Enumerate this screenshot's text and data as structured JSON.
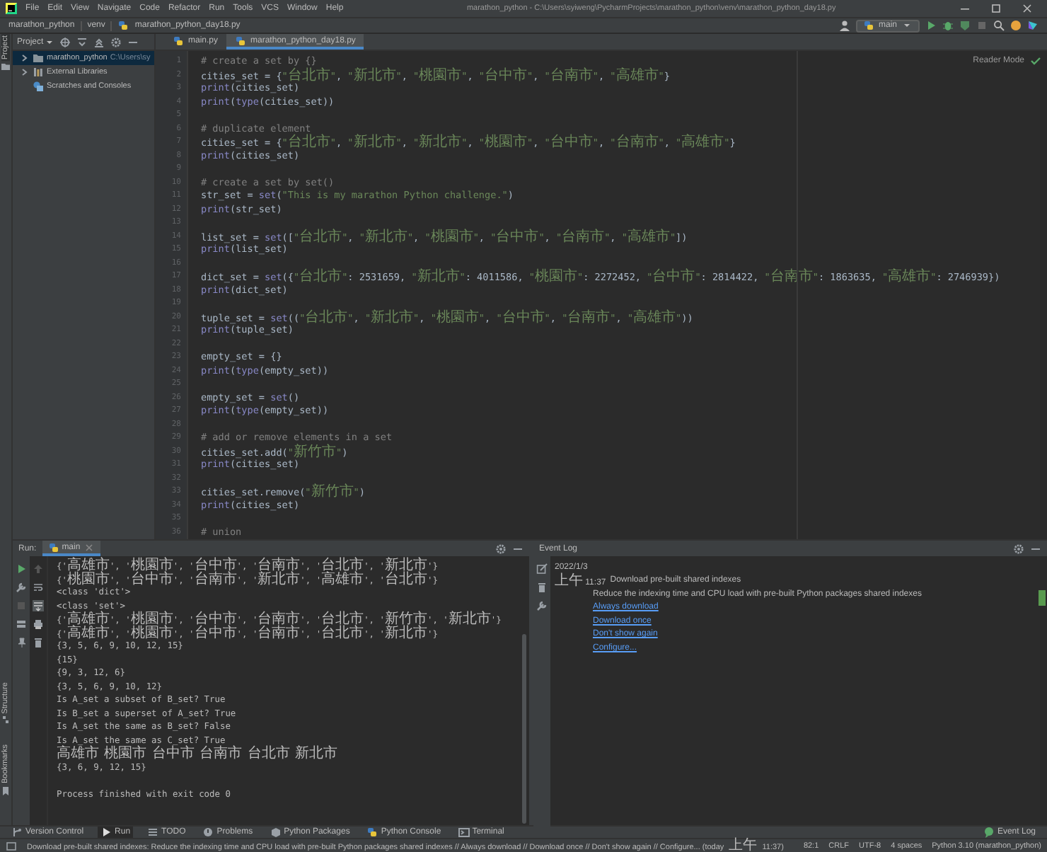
{
  "menu_bar": {
    "items": [
      "File",
      "Edit",
      "View",
      "Navigate",
      "Code",
      "Refactor",
      "Run",
      "Tools",
      "VCS",
      "Window",
      "Help"
    ],
    "title": "marathon_python - C:\\Users\\syiweng\\PycharmProjects\\marathon_python\\venv\\marathon_python_day18.py"
  },
  "nav_bar": {
    "breadcrumbs": [
      "marathon_python",
      "venv",
      "marathon_python_day18.py"
    ],
    "run_config": "main"
  },
  "left_strip": [
    {
      "label": "Project",
      "kind": "project",
      "selected": true
    },
    {
      "label": "Structure",
      "kind": "structure",
      "selected": false
    },
    {
      "label": "Bookmarks",
      "kind": "bookmarks",
      "selected": false
    }
  ],
  "project_panel": {
    "title": "Project",
    "tree": [
      {
        "label": "marathon_python",
        "path": "C:\\Users\\sy",
        "kind": "folder",
        "selected": true
      },
      {
        "label": "External Libraries",
        "kind": "library",
        "selected": false
      },
      {
        "label": "Scratches and Consoles",
        "kind": "scratches",
        "selected": false
      }
    ]
  },
  "editor": {
    "tabs": [
      {
        "label": "main.py",
        "selected": false
      },
      {
        "label": "marathon_python_day18.py",
        "selected": true
      }
    ],
    "reader_mode": "Reader Mode",
    "lines": [
      {
        "number": "1",
        "text": "# create a set by {}"
      },
      {
        "number": "2",
        "text": "cities_set = {\"台北市\", \"新北市\", \"桃園市\", \"台中市\", \"台南市\", \"高雄市\"}"
      },
      {
        "number": "3",
        "text": "print(cities_set)"
      },
      {
        "number": "4",
        "text": "print(type(cities_set))"
      },
      {
        "number": "5"
      },
      {
        "number": "6",
        "text": "# duplicate element"
      },
      {
        "number": "7",
        "text": "cities_set = {\"台北市\", \"新北市\", \"新北市\", \"桃園市\", \"台中市\", \"台南市\", \"高雄市\"}"
      },
      {
        "number": "8",
        "text": "print(cities_set)"
      },
      {
        "number": "9"
      },
      {
        "number": "10",
        "text": "# create a set by set()"
      },
      {
        "number": "11",
        "text": "str_set = set(\"This is my marathon Python challenge.\")"
      },
      {
        "number": "12",
        "text": "print(str_set)"
      },
      {
        "number": "13"
      },
      {
        "number": "14",
        "text": "list_set = set([\"台北市\", \"新北市\", \"桃園市\", \"台中市\", \"台南市\", \"高雄市\"])"
      },
      {
        "number": "15",
        "text": "print(list_set)"
      },
      {
        "number": "16"
      },
      {
        "number": "17",
        "text": "dict_set = set({\"台北市\": 2531659, \"新北市\": 4011586, \"桃園市\": 2272452, \"台中市\": 2814422, \"台南市\": 1863635, \"高雄市\": 2746939})"
      },
      {
        "number": "18",
        "text": "print(dict_set)"
      },
      {
        "number": "19"
      },
      {
        "number": "20",
        "text": "tuple_set = set((\"台北市\", \"新北市\", \"桃園市\", \"台中市\", \"台南市\", \"高雄市\"))"
      },
      {
        "number": "21",
        "text": "print(tuple_set)"
      },
      {
        "number": "22"
      },
      {
        "number": "23",
        "text": "empty_set = {}"
      },
      {
        "number": "24",
        "text": "print(type(empty_set))"
      },
      {
        "number": "25"
      },
      {
        "number": "26",
        "text": "empty_set = set()"
      },
      {
        "number": "27",
        "text": "print(type(empty_set))"
      },
      {
        "number": "28"
      },
      {
        "number": "29",
        "text": "# add or remove elements in a set"
      },
      {
        "number": "30",
        "text": "cities_set.add(\"新竹市\")"
      },
      {
        "number": "31",
        "text": "print(cities_set)"
      },
      {
        "number": "32"
      },
      {
        "number": "33",
        "text": "cities_set.remove(\"新竹市\")"
      },
      {
        "number": "34",
        "text": "print(cities_set)"
      },
      {
        "number": "35"
      },
      {
        "number": "36",
        "text": "# union"
      }
    ]
  },
  "run_panel": {
    "title": "Run:",
    "tab": "main",
    "output": [
      {
        "kind": "stdout",
        "text": "{'高雄市', '桃園市', '台中市', '台南市', '台北市', '新北市'}"
      },
      {
        "kind": "stdout",
        "text": "{'桃園市', '台中市', '台南市', '新北市', '高雄市', '台北市'}"
      },
      {
        "kind": "stdout",
        "text": "<class 'dict'>"
      },
      {
        "kind": "stdout",
        "text": "<class 'set'>"
      },
      {
        "kind": "stdout",
        "text": "{'高雄市', '桃園市', '台中市', '台南市', '台北市', '新竹市', '新北市'}"
      },
      {
        "kind": "stdout",
        "text": "{'高雄市', '桃園市', '台中市', '台南市', '台北市', '新北市'}"
      },
      {
        "kind": "stdout",
        "text": "{3, 5, 6, 9, 10, 12, 15}"
      },
      {
        "kind": "stdout",
        "text": "{15}"
      },
      {
        "kind": "stdout",
        "text": "{9, 3, 12, 6}"
      },
      {
        "kind": "stdout",
        "text": "{3, 5, 6, 9, 10, 12}"
      },
      {
        "kind": "stdout",
        "text": "Is A_set a subset of B_set? True"
      },
      {
        "kind": "stdout",
        "text": "Is B_set a superset of A_set? True"
      },
      {
        "kind": "stdout",
        "text": "Is A_set the same as B_set? False"
      },
      {
        "kind": "stdout",
        "text": "Is A_set the same as C_set? True"
      },
      {
        "kind": "stdout",
        "text": "高雄市 桃園市 台中市 台南市 台北市 新北市"
      },
      {
        "kind": "stdout",
        "text": "{3, 6, 9, 12, 15}"
      },
      {
        "kind": "exit",
        "text": "Process finished with exit code 0"
      }
    ]
  },
  "event_log": {
    "title": "Event Log",
    "date": "2022/1/3",
    "time": "上午 11:37",
    "heading": "Download pre-built shared indexes",
    "message": "Reduce the indexing time and CPU load with pre-built Python packages shared indexes",
    "links": [
      "Always download",
      "Download once",
      "Don't show again",
      "Configure..."
    ]
  },
  "tool_windows": [
    {
      "label": "Version Control",
      "kind": "vcs",
      "selected": false
    },
    {
      "label": "Run",
      "kind": "run",
      "selected": true
    },
    {
      "label": "TODO",
      "kind": "todo",
      "selected": false
    },
    {
      "label": "Problems",
      "kind": "problems",
      "selected": false
    },
    {
      "label": "Python Packages",
      "kind": "packages",
      "selected": false
    },
    {
      "label": "Python Console",
      "kind": "console",
      "selected": false
    },
    {
      "label": "Terminal",
      "kind": "terminal",
      "selected": false
    }
  ],
  "event_log_button": "Event Log",
  "status_bar": {
    "message": "Download pre-built shared indexes: Reduce the indexing time and CPU load with pre-built Python packages shared indexes // Always download // Download once // Don't show again // Configure... (today 上午 11:37)",
    "position": "82:1",
    "line_separator": "CRLF",
    "encoding": "UTF-8",
    "indent": "4 spaces",
    "interpreter": "Python 3.10 (marathon_python)"
  }
}
